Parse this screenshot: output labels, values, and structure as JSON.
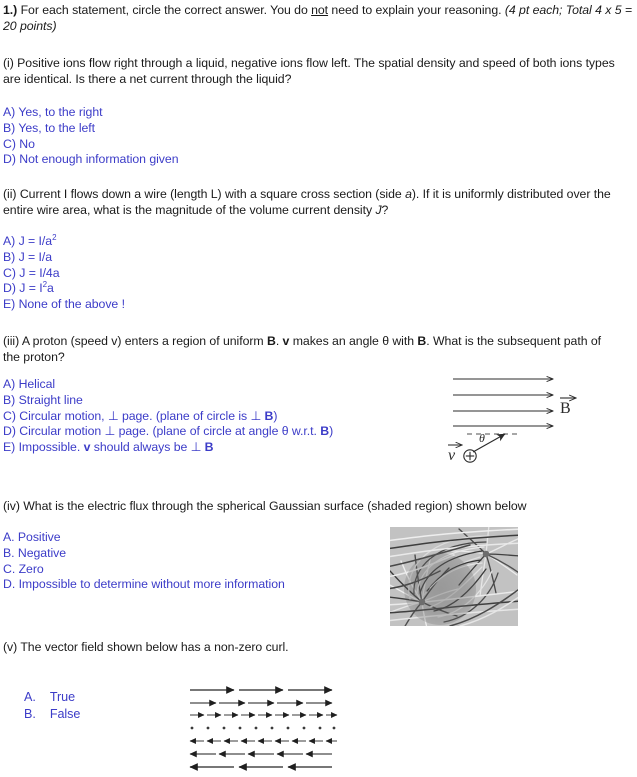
{
  "document": {
    "type": "physics-exam-question-page",
    "colors": {
      "answer_blue": "#3c3cc8",
      "body_text": "#1a1a1a",
      "page_background": "#ffffff"
    }
  },
  "header": {
    "number": "1.)",
    "instruction_before_not": " For each statement, circle the correct answer.  You do ",
    "emphasis_not": "not",
    "instruction_after_not": " need to explain your reasoning.  ",
    "points_note": "(4 pt each; Total 4 x 5 = 20 points)"
  },
  "questions": [
    {
      "id": "i",
      "label": "(i)",
      "stem": "(i) Positive ions flow right through a liquid, negative ions flow left.  The spatial density and speed of both ions types are identical. Is there a net current through the liquid?",
      "options": [
        "A) Yes, to the right",
        "B) Yes, to the left",
        "C) No",
        "D) Not enough information given"
      ]
    },
    {
      "id": "ii",
      "label": "(ii)",
      "stem_part1": "(ii) Current I flows down a wire (length L) with a square cross section (side ",
      "stem_italic_a": "a",
      "stem_part2": "). If it is uniformly distributed over the entire wire area, what is the magnitude of the volume current density ",
      "stem_italic_J": "J",
      "stem_part3": "?",
      "options": [
        {
          "prefix": "A) J = I/a",
          "sup": "2",
          "suffix": ""
        },
        {
          "prefix": "B) J = I/a",
          "sup": "",
          "suffix": ""
        },
        {
          "prefix": "C) J = I/4a",
          "sup": "",
          "suffix": ""
        },
        {
          "prefix": "D) J = I",
          "sup": "2",
          "suffix": "a"
        },
        {
          "prefix": "E) None of the above !",
          "sup": "",
          "suffix": ""
        }
      ]
    },
    {
      "id": "iii",
      "label": "(iii)",
      "stem_p1": "(iii) A proton (speed v) enters a region of uniform ",
      "stem_b1": "B",
      "stem_p2": ". ",
      "stem_v1": "v",
      "stem_p3": " makes an angle θ with ",
      "stem_b2": "B",
      "stem_p4": ". What is the subsequent path of the proton?",
      "options": [
        {
          "text": "A) Helical"
        },
        {
          "text": "B) Straight line"
        },
        {
          "pre": "C) Circular motion, ⊥ page. (plane of circle is ⊥ ",
          "bold": "B",
          "post": ")"
        },
        {
          "pre": "D) Circular motion ⊥ page. (plane of circle at angle θ w.r.t. ",
          "bold": "B",
          "post": ")"
        },
        {
          "pre": "E) Impossible.  ",
          "bold_v": "v",
          "mid": " should always be ⊥ ",
          "bold": "B",
          "post": ""
        }
      ],
      "figure": {
        "name": "uniform-b-field-with-proton-diagram",
        "field_arrow_count": 4,
        "field_label": "B",
        "velocity_label": "v",
        "angle_label": "θ",
        "charge_symbol": "⊕",
        "description": "Four horizontal right-pointing field lines labelled B-vector; a positive charge at lower left with velocity vector v at angle theta above a dashed horizontal reference line"
      }
    },
    {
      "id": "iv",
      "label": "(iv)",
      "stem": "(iv) What is the electric flux through the spherical Gaussian surface (shaded region) shown below",
      "options": [
        "A. Positive",
        "B. Negative",
        "C. Zero",
        "D. Impossible to determine without more information"
      ],
      "figure": {
        "name": "electric-field-line-dipole-with-gaussian-surface",
        "description": "Grayscale line-integral-convolution rendering of an electric dipole field with a shaded circular Gaussian region overlapping the lower-left charge",
        "charge_count": 2,
        "shaded_region": "circle"
      }
    },
    {
      "id": "v",
      "label": "(v)",
      "stem": "(v) The vector field shown below has a non-zero curl.",
      "options": [
        {
          "letter": "A.",
          "text": "True"
        },
        {
          "letter": "B.",
          "text": "False"
        }
      ],
      "figure": {
        "name": "shear-vector-field-diagram",
        "description": "Horizontal shear flow: long rightward arrows at the top shrink to zero at the middle row of dots, then grow as leftward arrows toward the bottom",
        "rows": [
          {
            "direction": "right",
            "count": 3,
            "length": 44
          },
          {
            "direction": "right",
            "count": 5,
            "length": 26
          },
          {
            "direction": "right",
            "count": 9,
            "length": 14
          },
          {
            "direction": "none",
            "count": 10,
            "length": 2
          },
          {
            "direction": "left",
            "count": 9,
            "length": 14
          },
          {
            "direction": "left",
            "count": 5,
            "length": 26
          },
          {
            "direction": "left",
            "count": 3,
            "length": 44
          }
        ]
      }
    }
  ]
}
